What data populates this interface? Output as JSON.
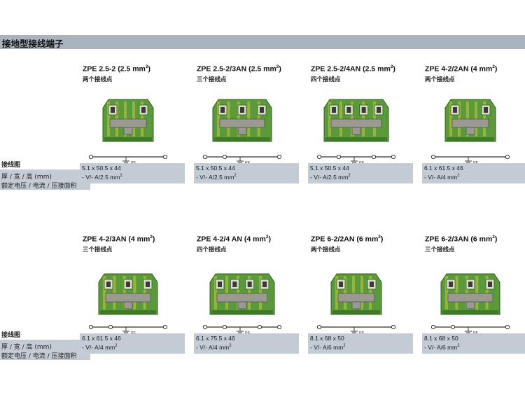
{
  "header": {
    "title": "接地型接线端子"
  },
  "labels": {
    "wiring": "接线图",
    "dimensions": "厚 / 宽 / 高 (mm)",
    "ratings": "额定电压 / 电流 / 压接面积"
  },
  "colors": {
    "header_bg": "#a9b3bb",
    "spec_bg": "#c3ccd4",
    "terminal_green": "#5a9a3a",
    "terminal_yellow": "#c8c840",
    "terminal_gray": "#9a9a90"
  },
  "products": [
    {
      "title": "ZPE 2.5-2 (2.5 mm",
      "title_sup": "2",
      "title_end": ")",
      "points": "两个接线点",
      "dims": "5.1 x 50.5 x 44",
      "rating": "- V/- A/2.5 mm",
      "rating_sup": "2",
      "nodes": 2,
      "pe": "PE",
      "layout": "two"
    },
    {
      "title": "ZPE 2.5-2/3AN (2.5 mm",
      "title_sup": "2",
      "title_end": ")",
      "points": "三个接线点",
      "dims": "5.1 x 50.5 x 44",
      "rating": "- V/- A/2.5 mm",
      "rating_sup": "2",
      "nodes": 3,
      "pe": "PE",
      "layout": "three"
    },
    {
      "title": "ZPE 2.5-2/4AN (2.5 mm",
      "title_sup": "2",
      "title_end": ")",
      "points": "四个接线点",
      "dims": "5.1 x 50.5 x 44",
      "rating": "- V/- A/2.5 mm",
      "rating_sup": "2",
      "nodes": 4,
      "pe": "PE",
      "layout": "four"
    },
    {
      "title": "ZPE 4-2/2AN (4 mm",
      "title_sup": "2",
      "title_end": ")",
      "points": "两个接线点",
      "dims": "6.1 x 61.5 x 46",
      "rating": "- V/- A/4 mm",
      "rating_sup": "2",
      "nodes": 2,
      "pe": "PE",
      "layout": "two"
    },
    {
      "title": "ZPE 4-2/3AN (4 mm",
      "title_sup": "2",
      "title_end": ")",
      "points": "三个接线点",
      "dims": "6.1 x 61.5 x 46",
      "rating": "- V/- A/4 mm",
      "rating_sup": "2",
      "nodes": 3,
      "pe": "PE",
      "layout": "three"
    },
    {
      "title": "ZPE 4-2/4 AN (4 mm",
      "title_sup": "2",
      "title_end": ")",
      "points": "四个接线点",
      "dims": "6.1 x 75.5 x 46",
      "rating": "- V/- A/4 mm",
      "rating_sup": "2",
      "nodes": 4,
      "pe": "PE",
      "layout": "four"
    },
    {
      "title": "ZPE 6-2/2AN (6 mm",
      "title_sup": "2",
      "title_end": ")",
      "points": "两个接线点",
      "dims": "8.1 x 68 x 50",
      "rating": "- V/- A/6 mm",
      "rating_sup": "2",
      "nodes": 2,
      "pe": "PE",
      "layout": "two"
    },
    {
      "title": "ZPE 6-2/3AN (6 mm",
      "title_sup": "2",
      "title_end": ")",
      "points": "三个接线点",
      "dims": "8.1 x 68 x 50",
      "rating": "- V/- A/6 mm",
      "rating_sup": "2",
      "nodes": 3,
      "pe": "PE",
      "layout": "three"
    }
  ]
}
